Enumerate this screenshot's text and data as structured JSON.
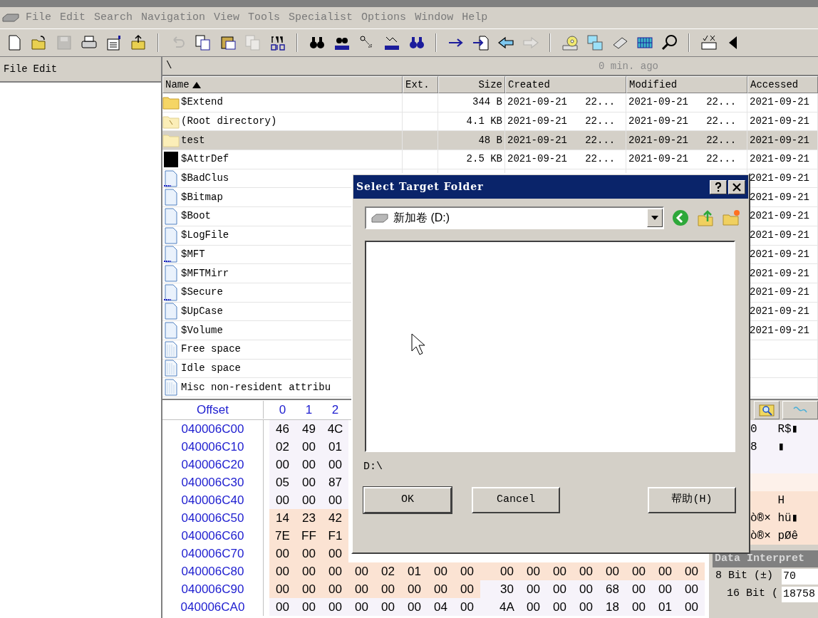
{
  "menu": [
    {
      "label": "File"
    },
    {
      "label": "Edit"
    },
    {
      "label": "Search"
    },
    {
      "label": "Navigation"
    },
    {
      "label": "View"
    },
    {
      "label": "Tools"
    },
    {
      "label": "Specialist"
    },
    {
      "label": "Options"
    },
    {
      "label": "Window"
    },
    {
      "label": "Help"
    }
  ],
  "toolbar": [
    {
      "kind": "new",
      "disabled": false
    },
    {
      "kind": "open",
      "disabled": false
    },
    {
      "kind": "save",
      "disabled": true
    },
    {
      "kind": "print",
      "disabled": false
    },
    {
      "kind": "properties",
      "disabled": false
    },
    {
      "kind": "export",
      "disabled": false
    },
    {
      "kind": "separator"
    },
    {
      "kind": "undo",
      "disabled": true
    },
    {
      "kind": "copy",
      "disabled": false
    },
    {
      "kind": "paste",
      "disabled": false
    },
    {
      "kind": "copy",
      "disabled": true
    },
    {
      "kind": "binary",
      "disabled": false
    },
    {
      "kind": "separator"
    },
    {
      "kind": "find",
      "disabled": false
    },
    {
      "kind": "find-hex",
      "disabled": false
    },
    {
      "kind": "replace",
      "disabled": false
    },
    {
      "kind": "replace-hex",
      "disabled": false
    },
    {
      "kind": "find-blue",
      "disabled": false
    },
    {
      "kind": "separator"
    },
    {
      "kind": "arrow",
      "disabled": false
    },
    {
      "kind": "goto",
      "disabled": false
    },
    {
      "kind": "back",
      "disabled": false
    },
    {
      "kind": "forward",
      "disabled": true
    },
    {
      "kind": "separator"
    },
    {
      "kind": "disk",
      "disabled": false
    },
    {
      "kind": "windows",
      "disabled": false
    },
    {
      "kind": "ram",
      "disabled": false
    },
    {
      "kind": "grid",
      "disabled": false
    },
    {
      "kind": "magnifier",
      "disabled": false
    },
    {
      "kind": "separator"
    },
    {
      "kind": "check",
      "disabled": false
    },
    {
      "kind": "triangle",
      "disabled": false
    }
  ],
  "left_panel": {
    "menu": [
      "File",
      "Edit"
    ]
  },
  "path_bar": {
    "path": "\\",
    "age": "0 min. ago"
  },
  "file_table": {
    "columns": [
      {
        "label": "Name",
        "sorted": true
      },
      {
        "label": "Ext.",
        "sorted": false
      },
      {
        "label": "Size",
        "sorted": false
      },
      {
        "label": "Created",
        "sorted": false
      },
      {
        "label": "Modified",
        "sorted": false
      },
      {
        "label": "Accessed",
        "sorted": false
      }
    ],
    "rows": [
      {
        "kind": "folder",
        "name": "$Extend",
        "size": "344 B",
        "created": "2021-09-21   22...",
        "modified": "2021-09-21   22...",
        "accessed": "2021-09-21",
        "selected": false
      },
      {
        "kind": "folder-root",
        "name": "(Root directory)",
        "size": "4.1 KB",
        "created": "2021-09-21   22...",
        "modified": "2021-09-21   22...",
        "accessed": "2021-09-21",
        "selected": false
      },
      {
        "kind": "folder-unknown",
        "name": "test",
        "size": "48 B",
        "created": "2021-09-21   22...",
        "modified": "2021-09-21   22...",
        "accessed": "2021-09-21",
        "selected": true
      },
      {
        "kind": "system",
        "name": "$AttrDef",
        "size": "2.5 KB",
        "created": "2021-09-21   22...",
        "modified": "2021-09-21   22...",
        "accessed": "2021-09-21",
        "selected": false
      },
      {
        "kind": "file-dots",
        "name": "$BadClus",
        "accessed": "2021-09-21",
        "selected": false
      },
      {
        "kind": "file",
        "name": "$Bitmap",
        "accessed": "2021-09-21",
        "selected": false
      },
      {
        "kind": "file",
        "name": "$Boot",
        "accessed": "2021-09-21",
        "selected": false
      },
      {
        "kind": "file",
        "name": "$LogFile",
        "accessed": "2021-09-21",
        "selected": false
      },
      {
        "kind": "file-dots",
        "name": "$MFT",
        "accessed": "2021-09-21",
        "selected": false
      },
      {
        "kind": "file",
        "name": "$MFTMirr",
        "accessed": "2021-09-21",
        "selected": false
      },
      {
        "kind": "file-dots",
        "name": "$Secure",
        "accessed": "2021-09-21",
        "selected": false
      },
      {
        "kind": "file",
        "name": "$UpCase",
        "accessed": "2021-09-21",
        "selected": false
      },
      {
        "kind": "file",
        "name": "$Volume",
        "accessed": "2021-09-21",
        "selected": false
      },
      {
        "kind": "file-grid",
        "name": "Free space",
        "selected": false
      },
      {
        "kind": "file-grid",
        "name": "Idle space",
        "selected": false
      },
      {
        "kind": "file-grid",
        "name": "Misc non-resident attribu",
        "selected": false
      }
    ]
  },
  "hex": {
    "columns": [
      "Offset",
      "0",
      "1",
      "2"
    ],
    "rows": [
      {
        "offset": "040006C00",
        "groups": [
          {
            "selected": false,
            "bytes": [
              "46",
              "49",
              "4C"
            ]
          }
        ],
        "ascii": "0   R$▮"
      },
      {
        "offset": "040006C10",
        "groups": [
          {
            "selected": false,
            "bytes": [
              "02",
              "00",
              "01"
            ]
          }
        ],
        "ascii": "8   ▮"
      },
      {
        "offset": "040006C20",
        "groups": [
          {
            "selected": false,
            "bytes": [
              "00",
              "00",
              "00"
            ]
          }
        ],
        "ascii_selected": false
      },
      {
        "offset": "040006C30",
        "groups": [
          {
            "selected": false,
            "bytes": [
              "05",
              "00",
              "87"
            ]
          }
        ],
        "ascii_selected": true
      },
      {
        "offset": "040006C40",
        "groups": [
          {
            "selected": false,
            "bytes": [
              "00",
              "00",
              "00"
            ]
          }
        ],
        "ascii": "    H",
        "ascii_selected": true
      },
      {
        "offset": "040006C50",
        "groups": [
          {
            "selected": true,
            "bytes": [
              "14",
              "23",
              "42"
            ]
          }
        ],
        "ascii": "ò®× hü▮",
        "ascii_selected": true
      },
      {
        "offset": "040006C60",
        "groups": [
          {
            "selected": true,
            "bytes": [
              "7E",
              "FF",
              "F1"
            ]
          }
        ],
        "ascii": "ò®× pØê",
        "ascii_selected": true
      },
      {
        "offset": "040006C70",
        "groups": [
          {
            "selected": true,
            "bytes": [
              "00",
              "00",
              "00"
            ]
          }
        ]
      },
      {
        "offset": "040006C80",
        "groups": [
          {
            "selected": true,
            "bytes": [
              "00",
              "00",
              "00",
              "00",
              "02",
              "01",
              "00",
              "00",
              "00",
              "00",
              "00",
              "00",
              "00",
              "00",
              "00",
              "00"
            ]
          }
        ]
      },
      {
        "offset": "040006C90",
        "groups": [
          {
            "selected": true,
            "bytes": [
              "00",
              "00",
              "00",
              "00",
              "00",
              "00",
              "00",
              "00"
            ]
          },
          {
            "selected": false,
            "bytes": [
              "30",
              "00",
              "00",
              "00",
              "68",
              "00",
              "00",
              "00"
            ]
          }
        ]
      },
      {
        "offset": "040006CA0",
        "groups": [
          {
            "selected": false,
            "bytes": [
              "00",
              "00",
              "00",
              "00",
              "00",
              "00",
              "04",
              "00",
              "4A",
              "00",
              "00",
              "00",
              "18",
              "00",
              "01",
              "00"
            ]
          }
        ]
      }
    ]
  },
  "data_interpreter": {
    "title": "Data Interpret",
    "rows": [
      {
        "label": "8 Bit (±)",
        "value": "70"
      },
      {
        "label": "16 Bit (",
        "value": "18758"
      }
    ]
  },
  "dialog": {
    "title": "Select Target Folder",
    "drive": "新加卷 (D:)",
    "path": "D:\\",
    "buttons": [
      {
        "label": "OK",
        "default": true
      },
      {
        "label": "Cancel",
        "default": false
      },
      {
        "label": "帮助(H)",
        "default": false
      }
    ]
  }
}
